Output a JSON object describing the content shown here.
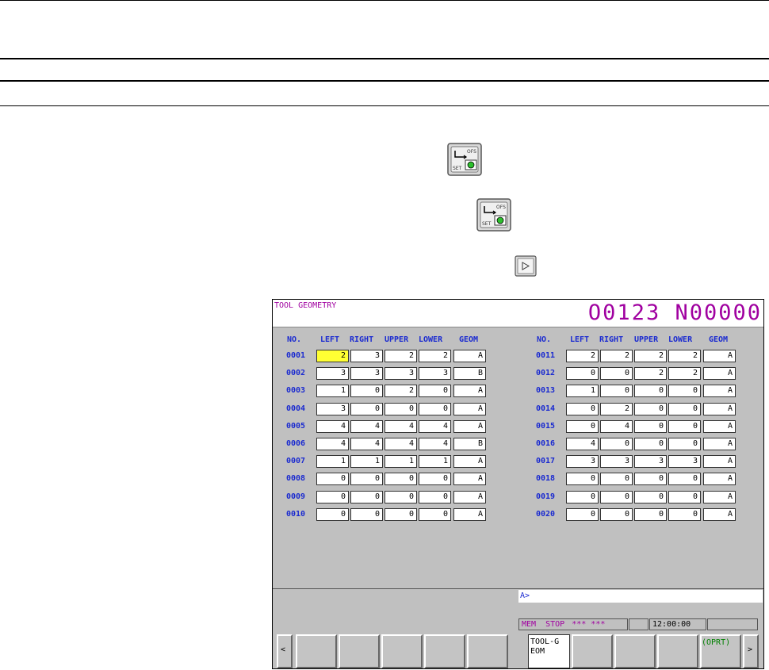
{
  "keys": {
    "offset_icon_1": "offset-setting-key-icon",
    "offset_icon_2": "offset-setting-key-icon",
    "cursor_icon": "right-arrow-key-icon"
  },
  "screen": {
    "title": "TOOL GEOMETRY",
    "program": "O0123 N00000",
    "columns": [
      "NO.",
      "LEFT",
      "RIGHT",
      "UPPER",
      "LOWER",
      "GEOM"
    ],
    "left_rows": [
      {
        "no": "0001",
        "vals": [
          "2",
          "3",
          "2",
          "2",
          "A"
        ]
      },
      {
        "no": "0002",
        "vals": [
          "3",
          "3",
          "3",
          "3",
          "B"
        ]
      },
      {
        "no": "0003",
        "vals": [
          "1",
          "0",
          "2",
          "0",
          "A"
        ]
      },
      {
        "no": "0004",
        "vals": [
          "3",
          "0",
          "0",
          "0",
          "A"
        ]
      },
      {
        "no": "0005",
        "vals": [
          "4",
          "4",
          "4",
          "4",
          "A"
        ]
      },
      {
        "no": "0006",
        "vals": [
          "4",
          "4",
          "4",
          "4",
          "B"
        ]
      },
      {
        "no": "0007",
        "vals": [
          "1",
          "1",
          "1",
          "1",
          "A"
        ]
      },
      {
        "no": "0008",
        "vals": [
          "0",
          "0",
          "0",
          "0",
          "A"
        ]
      },
      {
        "no": "0009",
        "vals": [
          "0",
          "0",
          "0",
          "0",
          "A"
        ]
      },
      {
        "no": "0010",
        "vals": [
          "0",
          "0",
          "0",
          "0",
          "A"
        ]
      }
    ],
    "right_rows": [
      {
        "no": "0011",
        "vals": [
          "2",
          "2",
          "2",
          "2",
          "A"
        ]
      },
      {
        "no": "0012",
        "vals": [
          "0",
          "0",
          "2",
          "2",
          "A"
        ]
      },
      {
        "no": "0013",
        "vals": [
          "1",
          "0",
          "0",
          "0",
          "A"
        ]
      },
      {
        "no": "0014",
        "vals": [
          "0",
          "2",
          "0",
          "0",
          "A"
        ]
      },
      {
        "no": "0015",
        "vals": [
          "0",
          "4",
          "0",
          "0",
          "A"
        ]
      },
      {
        "no": "0016",
        "vals": [
          "4",
          "0",
          "0",
          "0",
          "A"
        ]
      },
      {
        "no": "0017",
        "vals": [
          "3",
          "3",
          "3",
          "3",
          "A"
        ]
      },
      {
        "no": "0018",
        "vals": [
          "0",
          "0",
          "0",
          "0",
          "A"
        ]
      },
      {
        "no": "0019",
        "vals": [
          "0",
          "0",
          "0",
          "0",
          "A"
        ]
      },
      {
        "no": "0020",
        "vals": [
          "0",
          "0",
          "0",
          "0",
          "A"
        ]
      }
    ],
    "input_prompt": "A>",
    "status": {
      "mode": "MEM",
      "state": "STOP",
      "alarm": "*** ***",
      "time": "12:00:00"
    },
    "softkeys": {
      "left_arrow": "<",
      "tool_geom": "TOOL-G\nEOM",
      "oprt": "(OPRT)",
      "right_arrow": ">"
    }
  },
  "colors": {
    "title_magenta": "#a000a0",
    "label_blue": "#1a2ad0",
    "selected_cell": "#ffff33",
    "oprt_green": "#008000"
  }
}
